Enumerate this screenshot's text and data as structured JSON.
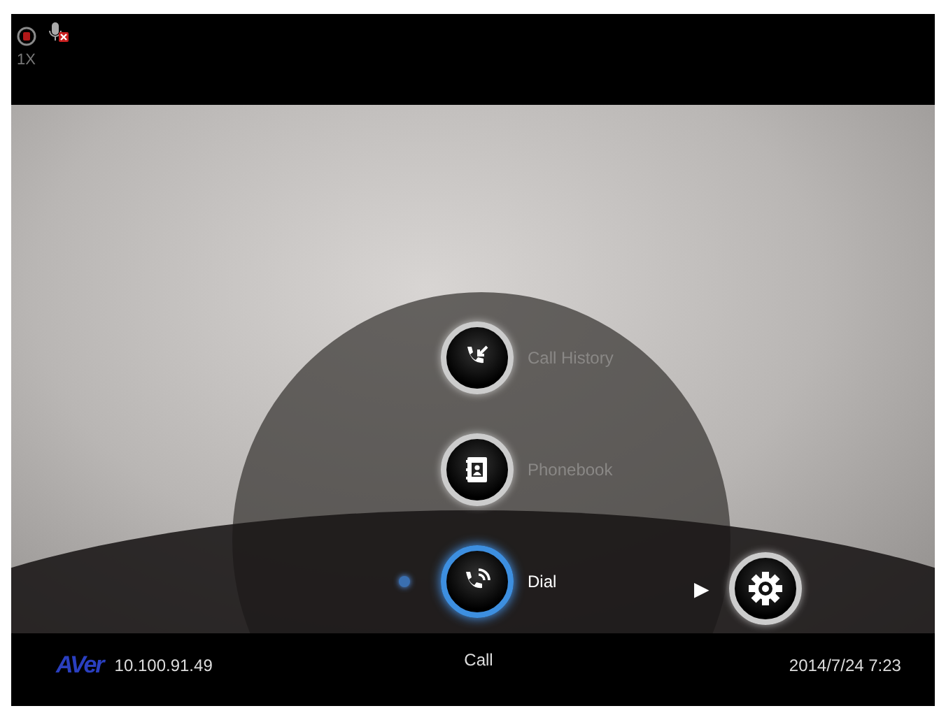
{
  "top_bar": {
    "zoom": "1X",
    "mic_muted": true
  },
  "menu": [
    {
      "label": "Call History",
      "kind": "history",
      "selected": false
    },
    {
      "label": "Phonebook",
      "kind": "phonebook",
      "selected": false
    },
    {
      "label": "Dial",
      "kind": "dial",
      "selected": true
    }
  ],
  "next_arrow": "▶",
  "bottom_bar": {
    "logo": "AVer",
    "ip": "10.100.91.49",
    "mode": "Call",
    "datetime": "2014/7/24 7:23"
  }
}
